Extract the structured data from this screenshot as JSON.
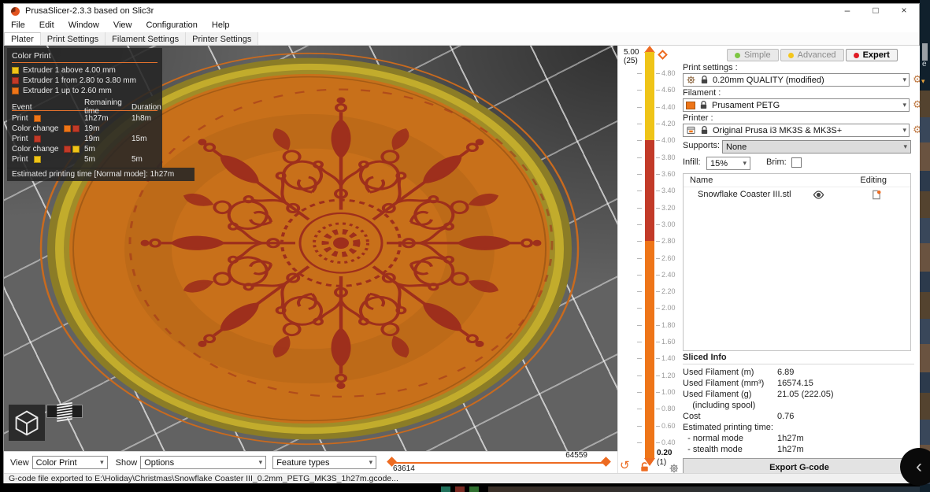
{
  "window": {
    "title": "PrusaSlicer-2.3.3 based on Slic3r",
    "minimize": "–",
    "maximize": "□",
    "close": "×"
  },
  "menu": {
    "items": [
      "File",
      "Edit",
      "Window",
      "View",
      "Configuration",
      "Help"
    ]
  },
  "tabs": {
    "items": [
      "Plater",
      "Print Settings",
      "Filament Settings",
      "Printer Settings"
    ],
    "active": "Plater"
  },
  "colors": {
    "yellow": "#EFC417",
    "red": "#C23A28",
    "orange": "#EE7518",
    "accent": "#ED6B21"
  },
  "legend": {
    "title": "Color Print",
    "extruders": [
      {
        "color": "yellow",
        "label": "Extruder 1 above 4.00 mm"
      },
      {
        "color": "red",
        "label": "Extruder 1 from 2.80 to 3.80 mm"
      },
      {
        "color": "orange",
        "label": "Extruder 1 up to 2.60 mm"
      }
    ],
    "columns": {
      "event": "Event",
      "remaining": "Remaining time",
      "duration": "Duration"
    },
    "events": [
      {
        "label": "Print",
        "colors": [
          "orange"
        ],
        "remaining": "1h27m",
        "duration": "1h8m"
      },
      {
        "label": "Color change",
        "colors": [
          "orange",
          "red"
        ],
        "remaining": "19m",
        "duration": ""
      },
      {
        "label": "Print",
        "colors": [
          "red"
        ],
        "remaining": "19m",
        "duration": "15m"
      },
      {
        "label": "Color change",
        "colors": [
          "red",
          "yellow"
        ],
        "remaining": "5m",
        "duration": ""
      },
      {
        "label": "Print",
        "colors": [
          "yellow"
        ],
        "remaining": "5m",
        "duration": "5m"
      }
    ],
    "estimated": "Estimated printing time [Normal mode]:  1h27m"
  },
  "vertical_slider": {
    "top_value": "5.00",
    "top_layer": "(25)",
    "bottom_value": "0.20",
    "bottom_layer": "(1)",
    "ticks": [
      "4.80",
      "4.60",
      "4.40",
      "4.20",
      "4.00",
      "3.80",
      "3.60",
      "3.40",
      "3.20",
      "3.00",
      "2.80",
      "2.60",
      "2.40",
      "2.20",
      "2.00",
      "1.80",
      "1.60",
      "1.40",
      "1.20",
      "1.00",
      "0.80",
      "0.60",
      "0.40"
    ]
  },
  "horizontal_slider": {
    "max_label": "64559",
    "min_label": "63614"
  },
  "mode_buttons": [
    {
      "label": "Simple",
      "dot": "#7dc642",
      "active": false
    },
    {
      "label": "Advanced",
      "dot": "#f4c61b",
      "active": false
    },
    {
      "label": "Expert",
      "dot": "#e01b24",
      "active": true
    }
  ],
  "right_panel": {
    "print_settings_label": "Print settings :",
    "print_settings_value": "0.20mm QUALITY (modified)",
    "filament_label": "Filament :",
    "filament_value": "Prusament PETG",
    "printer_label": "Printer :",
    "printer_value": "Original Prusa i3 MK3S & MK3S+",
    "supports_label": "Supports:",
    "supports_value": "None",
    "infill_label": "Infill:",
    "infill_value": "15%",
    "brim_label": "Brim:",
    "list": {
      "name_header": "Name",
      "editing_header": "Editing",
      "object_name": "Snowflake Coaster III.stl"
    },
    "sliced_info": {
      "title": "Sliced Info",
      "rows": [
        {
          "label": "Used Filament (m)",
          "value": "6.89"
        },
        {
          "label": "Used Filament (mm³)",
          "value": "16574.15"
        },
        {
          "label": "Used Filament (g)",
          "value": "21.05 (222.05)"
        },
        {
          "label": "    (including spool)",
          "value": ""
        },
        {
          "label": "Cost",
          "value": "0.76"
        },
        {
          "label": "Estimated printing time:",
          "value": ""
        },
        {
          "label": "  - normal mode",
          "value": "1h27m"
        },
        {
          "label": "  - stealth mode",
          "value": "1h27m"
        }
      ]
    },
    "export_button": "Export G-code"
  },
  "bottom_bar": {
    "view_label": "View",
    "view_value": "Color Print",
    "show_label": "Show",
    "show_value": "Options",
    "feature_types_value": "Feature types"
  },
  "status_bar": {
    "text": "G-code file exported to E:\\Holiday\\Christmas\\Snowflake Coaster III_0.2mm_PETG_MK3S_1h27m.gcode..."
  }
}
